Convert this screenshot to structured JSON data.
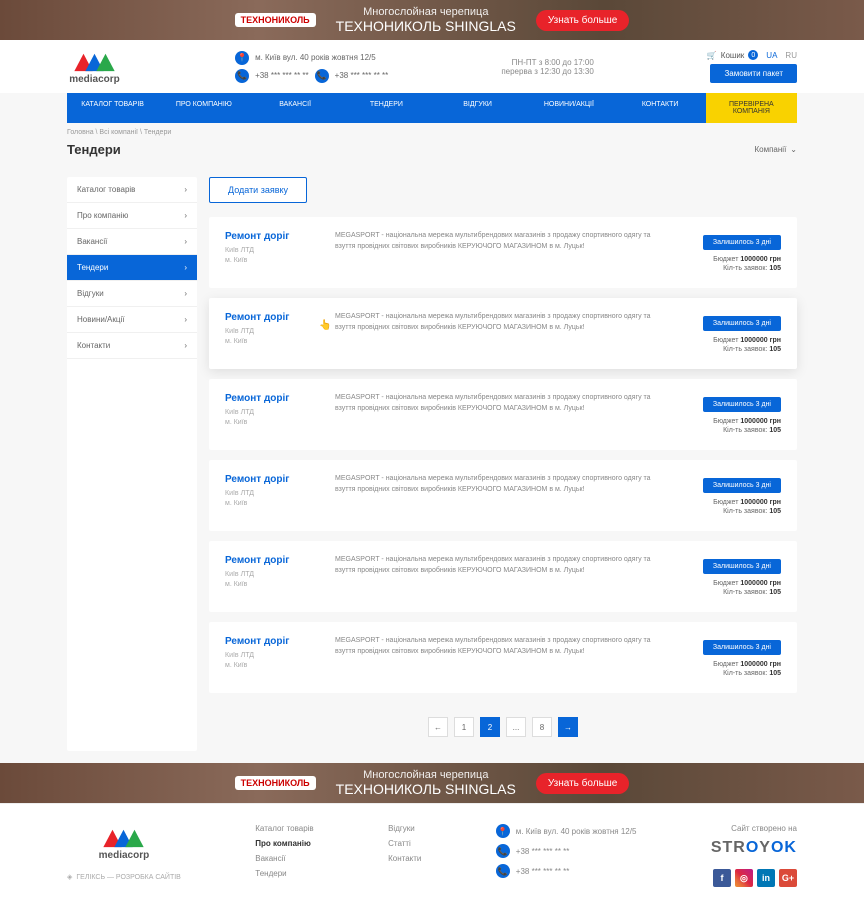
{
  "banner": {
    "logo": "ТЕХНОНИКОЛЬ",
    "line1": "Многослойная черепица",
    "line2": "ТЕХНОНИКОЛЬ SHINGLAS",
    "btn": "Узнать больше"
  },
  "header": {
    "brand": "mediacorp",
    "address": "м. Київ вул. 40 років жовтня 12/5",
    "phone1": "+38 *** *** ** **",
    "phone2": "+38 *** *** ** **",
    "hours1": "ПН-ПТ з 8:00 до 17:00",
    "hours2": "перерва з 12:30 до 13:30",
    "cart_label": "Кошик",
    "cart_count": "0",
    "lang_ua": "UA",
    "lang_ru": "RU",
    "order_btn": "Замовити пакет"
  },
  "nav": [
    "КАТАЛОГ ТОВАРІВ",
    "ПРО КОМПАНІЮ",
    "ВАКАНСІЇ",
    "ТЕНДЕРИ",
    "ВІДГУКИ",
    "НОВИНИ/АКЦІЇ",
    "КОНТАКТИ",
    "ПЕРЕВІРЕНА КОМПАНІЯ"
  ],
  "breadcrumb": "Головна \\ Всі компанії \\ Тендери",
  "page_title": "Тендери",
  "company_select": "Компанії",
  "sidebar": [
    {
      "label": "Каталог товарів",
      "active": false
    },
    {
      "label": "Про компанію",
      "active": false
    },
    {
      "label": "Вакансії",
      "active": false
    },
    {
      "label": "Тендери",
      "active": true
    },
    {
      "label": "Відгуки",
      "active": false
    },
    {
      "label": "Новини/Акції",
      "active": false
    },
    {
      "label": "Контакти",
      "active": false
    }
  ],
  "add_btn": "Додати заявку",
  "tender_template": {
    "title": "Ремонт доріг",
    "company": "Київ ЛТД",
    "city": "м. Київ",
    "desc": "MEGASPORT - національна мережа мультибрендових магазинів з продажу спортивного одягу та взуття провідних світових виробників КЕРУЮЧОГО МАГАЗИНОМ в м. Луцьк!",
    "days": "Залишилось 3 дні",
    "budget_label": "Бюджет",
    "budget_val": "1000000 грн",
    "apps_label": "Кіл-ть заявок:",
    "apps_val": "105"
  },
  "tender_count": 6,
  "highlighted_index": 1,
  "pagination": {
    "pages": [
      "1",
      "2",
      "...",
      "8"
    ],
    "active": 1
  },
  "footer": {
    "col1": [
      "Каталог товарів",
      "Про компанію",
      "Вакансії",
      "Тендери"
    ],
    "col2": [
      "Відгуки",
      "Статті",
      "Контакти"
    ],
    "address": "м. Київ вул. 40 років жовтня 12/5",
    "phone1": "+38 *** *** ** **",
    "phone2": "+38 *** *** ** **",
    "created": "Сайт створено на",
    "dev": "ГЕЛІКСЬ — РОЗРОБКА САЙТІВ"
  }
}
